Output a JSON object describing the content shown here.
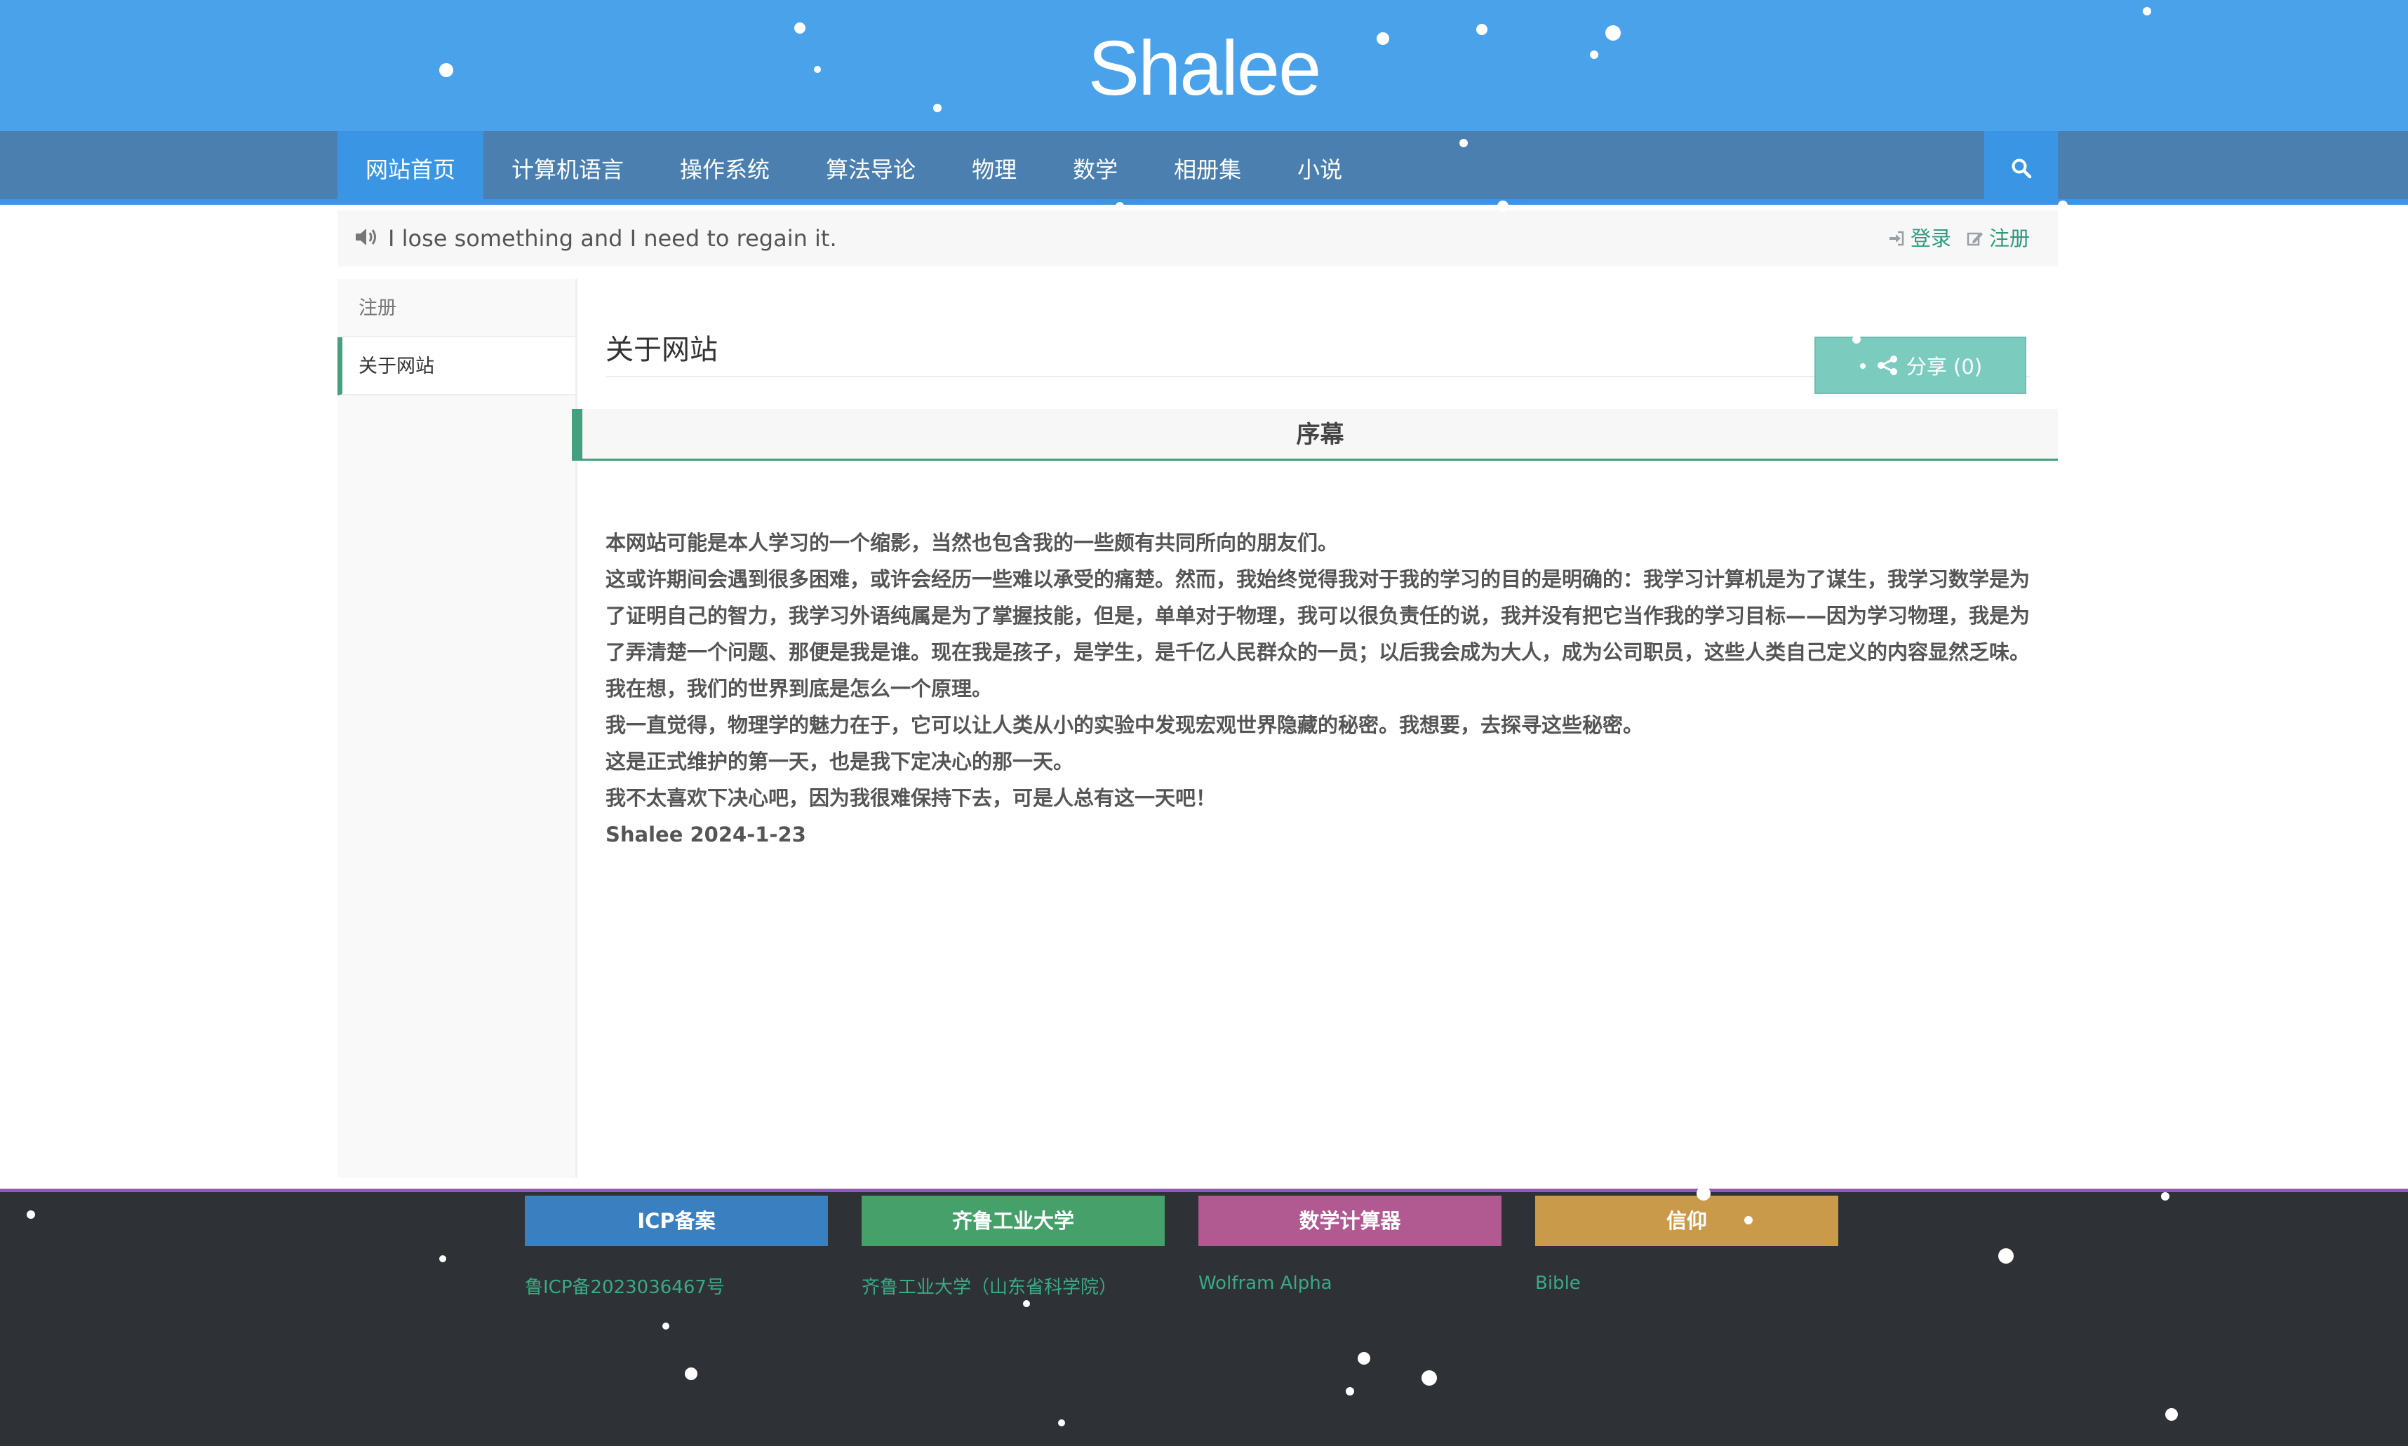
{
  "header": {
    "site_title": "Shalee"
  },
  "nav": {
    "items": [
      {
        "label": "网站首页",
        "active": true
      },
      {
        "label": "计算机语言"
      },
      {
        "label": "操作系统"
      },
      {
        "label": "算法导论"
      },
      {
        "label": "物理"
      },
      {
        "label": "数学"
      },
      {
        "label": "相册集"
      },
      {
        "label": "小说"
      }
    ],
    "search_icon": "search-icon"
  },
  "notice": {
    "icon": "volume-icon",
    "text": "I lose something and I need to regain it.",
    "login_label": "登录",
    "register_label": "注册"
  },
  "sidebar": {
    "items": [
      {
        "label": "注册"
      },
      {
        "label": "关于网站",
        "active": true
      }
    ]
  },
  "main": {
    "title": "关于网站",
    "share_label": "分享 (0)",
    "section_title": "序幕",
    "paragraphs": [
      "本网站可能是本人学习的一个缩影，当然也包含我的一些颇有共同所向的朋友们。",
      "这或许期间会遇到很多困难，或许会经历一些难以承受的痛楚。然而，我始终觉得我对于我的学习的目的是明确的：我学习计算机是为了谋生，我学习数学是为了证明自己的智力，我学习外语纯属是为了掌握技能，但是，单单对于物理，我可以很负责任的说，我并没有把它当作我的学习目标——因为学习物理，我是为了弄清楚一个问题、那便是我是谁。现在我是孩子，是学生，是千亿人民群众的一员；以后我会成为大人，成为公司职员，这些人类自己定义的内容显然乏味。我在想，我们的世界到底是怎么一个原理。",
      "我一直觉得，物理学的魅力在于，它可以让人类从小的实验中发现宏观世界隐藏的秘密。我想要，去探寻这些秘密。",
      "这是正式维护的第一天，也是我下定决心的那一天。",
      "我不太喜欢下决心吧，因为我很难保持下去，可是人总有这一天吧！",
      "Shalee 2024-1-23"
    ]
  },
  "footer": {
    "columns": [
      {
        "title": "ICP备案",
        "link": "鲁ICP备2023036467号",
        "color": "#3a7fc0"
      },
      {
        "title": "齐鲁工业大学",
        "link": "齐鲁工业大学（山东省科学院）",
        "color": "#46a06a"
      },
      {
        "title": "数学计算器",
        "link": "Wolfram Alpha",
        "color": "#b15a92"
      },
      {
        "title": "信仰",
        "link": "Bible",
        "color": "#c99a4a"
      }
    ]
  },
  "colors": {
    "banner": "#4aa3ea",
    "navbar": "#4a7fb0",
    "nav_active": "#3a96e4",
    "accent_green": "#45a07f",
    "share_button": "#7ccbbf",
    "footer_bg": "#2e3135"
  }
}
